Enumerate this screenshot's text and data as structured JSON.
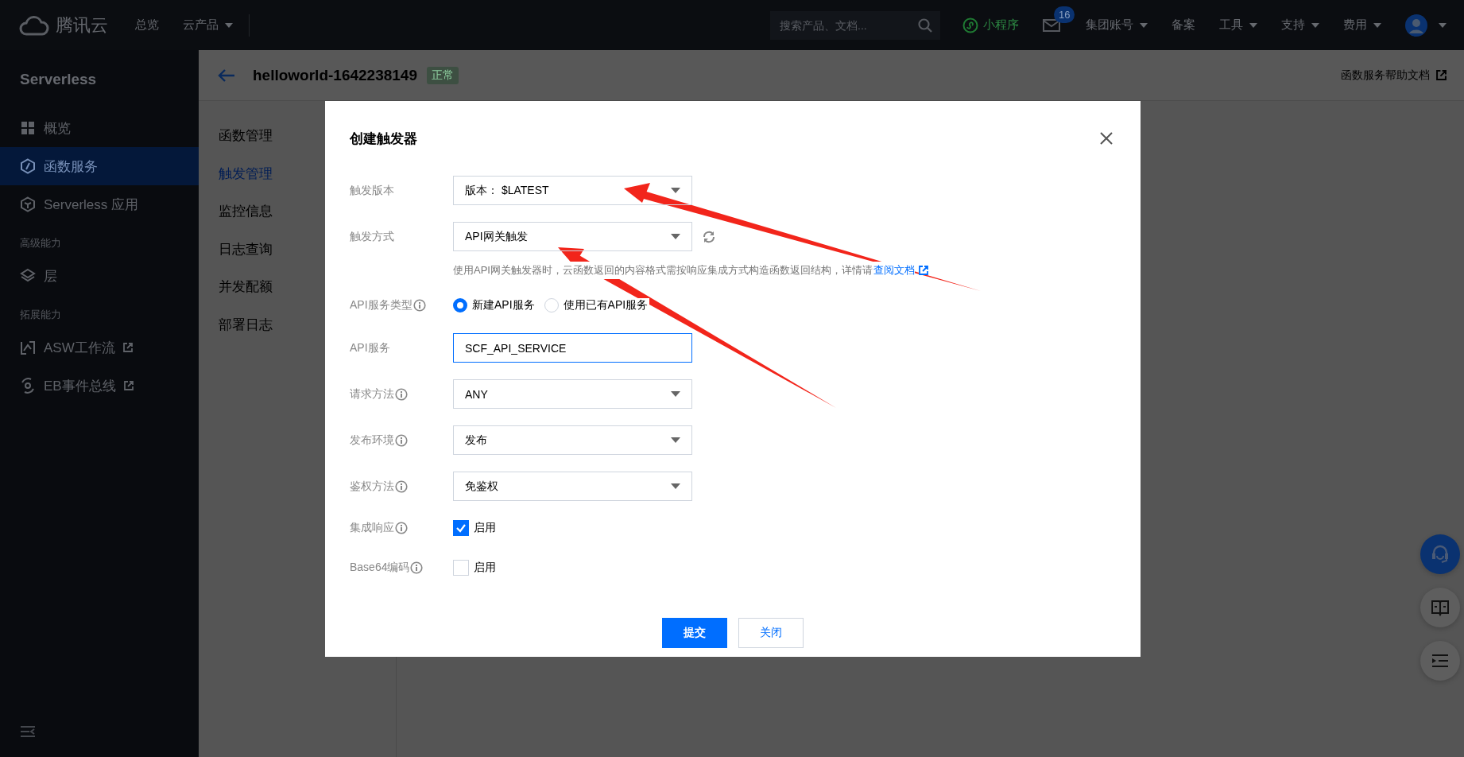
{
  "topbar": {
    "logo": "腾讯云",
    "nav": [
      {
        "label": "总览",
        "dropdown": false
      },
      {
        "label": "云产品",
        "dropdown": true
      }
    ],
    "search_placeholder": "搜索产品、文档...",
    "miniprogram": "小程序",
    "mail_badge": "16",
    "menus": [
      {
        "label": "集团账号",
        "dropdown": true
      },
      {
        "label": "备案",
        "dropdown": false
      },
      {
        "label": "工具",
        "dropdown": true
      },
      {
        "label": "支持",
        "dropdown": true
      },
      {
        "label": "费用",
        "dropdown": true
      }
    ]
  },
  "sidebar": {
    "title": "Serverless",
    "groups": [
      {
        "items": [
          {
            "kind": "grid",
            "label": "概览",
            "selected": false,
            "external": false
          },
          {
            "kind": "hexagon",
            "label": "函数服务",
            "selected": true,
            "external": false
          },
          {
            "kind": "cube",
            "label": "Serverless 应用",
            "selected": false,
            "external": false
          }
        ]
      },
      {
        "heading": "高级能力",
        "items": [
          {
            "kind": "layers",
            "label": "层",
            "selected": false,
            "external": false
          }
        ]
      },
      {
        "heading": "拓展能力",
        "items": [
          {
            "kind": "workflow",
            "label": "ASW工作流",
            "selected": false,
            "external": true
          },
          {
            "kind": "bus",
            "label": "EB事件总线",
            "selected": false,
            "external": true
          }
        ]
      }
    ]
  },
  "header": {
    "title": "helloworld-1642238149",
    "status": "正常",
    "help": "函数服务帮助文档"
  },
  "subnav": [
    {
      "label": "函数管理",
      "selected": false
    },
    {
      "label": "触发管理",
      "selected": true
    },
    {
      "label": "监控信息",
      "selected": false
    },
    {
      "label": "日志查询",
      "selected": false
    },
    {
      "label": "并发配额",
      "selected": false
    },
    {
      "label": "部署日志",
      "selected": false
    }
  ],
  "dialog": {
    "title": "创建触发器",
    "fields": [
      {
        "kind": "select",
        "label": "触发版本",
        "info": false,
        "value": "版本： $LATEST",
        "refresh": false
      },
      {
        "kind": "select",
        "label": "触发方式",
        "info": false,
        "value": "API网关触发",
        "refresh": true,
        "hint": "使用API网关触发器时，云函数返回的内容格式需按响应集成方式构造函数返回结构，详情请",
        "hint_link": "查阅文档"
      },
      {
        "kind": "radio",
        "label": "API服务类型",
        "info": true,
        "options": [
          {
            "label": "新建API服务",
            "selected": true
          },
          {
            "label": "使用已有API服务",
            "selected": false
          }
        ]
      },
      {
        "kind": "input",
        "label": "API服务",
        "info": false,
        "value": "SCF_API_SERVICE",
        "focused": true
      },
      {
        "kind": "select",
        "label": "请求方法",
        "info": true,
        "value": "ANY",
        "refresh": false
      },
      {
        "kind": "select",
        "label": "发布环境",
        "info": true,
        "value": "发布",
        "refresh": false
      },
      {
        "kind": "select",
        "label": "鉴权方法",
        "info": true,
        "value": "免鉴权",
        "refresh": false
      },
      {
        "kind": "checkbox",
        "label": "集成响应",
        "info": true,
        "option": "启用",
        "checked": true
      },
      {
        "kind": "checkbox",
        "label": "Base64编码",
        "info": true,
        "option": "启用",
        "checked": false
      }
    ],
    "buttons": [
      {
        "label": "提交",
        "kind": "primary"
      },
      {
        "label": "关闭",
        "kind": "default"
      }
    ]
  }
}
